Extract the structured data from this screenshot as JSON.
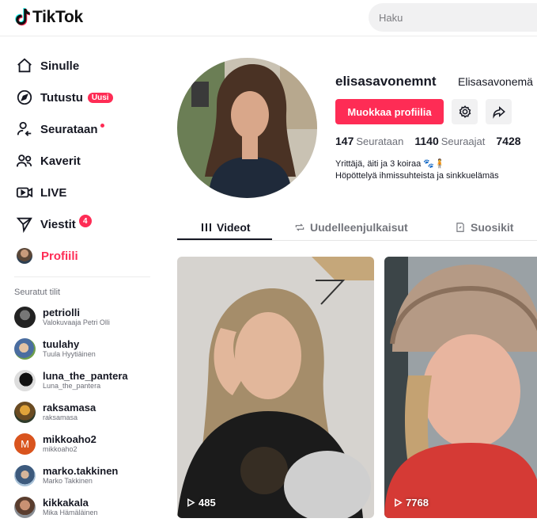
{
  "header": {
    "logo_text": "TikTok",
    "search_placeholder": "Haku"
  },
  "sidebar": {
    "nav": [
      {
        "label": "Sinulle",
        "icon": "home-icon"
      },
      {
        "label": "Tutustu",
        "icon": "compass-icon",
        "badge": "Uusi"
      },
      {
        "label": "Seurataan",
        "icon": "following-icon"
      },
      {
        "label": "Kaverit",
        "icon": "friends-icon"
      },
      {
        "label": "LIVE",
        "icon": "live-icon"
      },
      {
        "label": "Viestit",
        "icon": "send-icon",
        "badge": "4"
      },
      {
        "label": "Profiili",
        "icon": "avatar-icon"
      }
    ],
    "following_title": "Seuratut tilit",
    "accounts": [
      {
        "name": "petriolli",
        "sub": "Valokuvaaja Petri Olli"
      },
      {
        "name": "tuulahy",
        "sub": "Tuula Hyytiäinen"
      },
      {
        "name": "luna_the_pantera",
        "sub": "Luna_the_pantera"
      },
      {
        "name": "raksamasa",
        "sub": "raksamasa"
      },
      {
        "name": "mikkoaho2",
        "sub": "mikkoaho2",
        "initial": "M"
      },
      {
        "name": "marko.takkinen",
        "sub": "Marko Takkinen"
      },
      {
        "name": "kikkakala",
        "sub": "Mika Hämäläinen"
      }
    ]
  },
  "profile": {
    "username": "elisasavonemnt",
    "display_name": "Elisasavonemä",
    "edit_label": "Muokkaa profiilia",
    "stats": [
      {
        "value": "147",
        "label": "Seurataan"
      },
      {
        "value": "1140",
        "label": "Seuraajat"
      },
      {
        "value": "7428",
        "label": ""
      }
    ],
    "bio_line1": "Yrittäjä, äiti ja 3 koiraa 🐾🧍",
    "bio_line2": "Höpöttelyä ihmissuhteista ja sinkkuelämäs"
  },
  "tabs": [
    {
      "label": "Videot"
    },
    {
      "label": "Uudelleenjulkaisut"
    },
    {
      "label": "Suosikit"
    }
  ],
  "videos": [
    {
      "views": "485"
    },
    {
      "views": "7768"
    }
  ],
  "colors": {
    "accent": "#fe2c55",
    "text": "#161823"
  }
}
